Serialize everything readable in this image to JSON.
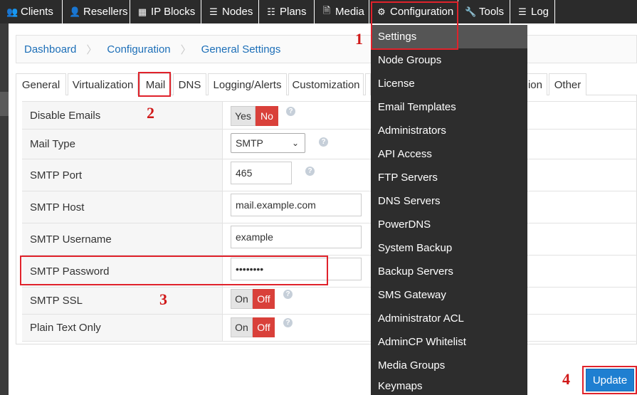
{
  "nav": {
    "items": [
      {
        "label": "Clients",
        "icon": "users-icon",
        "glyph": "👥"
      },
      {
        "label": "Resellers",
        "icon": "user-icon",
        "glyph": "👤"
      },
      {
        "label": "IP Blocks",
        "icon": "grid-icon",
        "glyph": "▦"
      },
      {
        "label": "Nodes",
        "icon": "server-icon",
        "glyph": "☰"
      },
      {
        "label": "Plans",
        "icon": "list-icon",
        "glyph": "☷"
      },
      {
        "label": "Media",
        "icon": "file-icon",
        "glyph": "🗎"
      },
      {
        "label": "Configuration",
        "icon": "gear-icon",
        "glyph": "⚙"
      },
      {
        "label": "Tools",
        "icon": "wrench-icon",
        "glyph": "🔧"
      },
      {
        "label": "Log",
        "icon": "list-icon",
        "glyph": "☰"
      }
    ]
  },
  "breadcrumb": [
    "Dashboard",
    "Configuration",
    "General Settings"
  ],
  "tabs": [
    "General",
    "Virtualization",
    "Mail",
    "DNS",
    "Logging/Alerts",
    "Customization",
    "ion",
    "Other"
  ],
  "form": {
    "disable_emails": {
      "label": "Disable Emails",
      "yes": "Yes",
      "no": "No"
    },
    "mail_type": {
      "label": "Mail Type",
      "value": "SMTP"
    },
    "smtp_port": {
      "label": "SMTP Port",
      "value": "465"
    },
    "smtp_host": {
      "label": "SMTP Host",
      "value": "mail.example.com"
    },
    "smtp_username": {
      "label": "SMTP Username",
      "value": "example"
    },
    "smtp_password": {
      "label": "SMTP Password",
      "value": "••••••••"
    },
    "smtp_ssl": {
      "label": "SMTP SSL",
      "on": "On",
      "off": "Off"
    },
    "plain_text": {
      "label": "Plain Text Only",
      "on": "On",
      "off": "Off"
    },
    "help_glyph": "?"
  },
  "dropdown": {
    "items": [
      "Settings",
      "Node Groups",
      "License",
      "Email Templates",
      "Administrators",
      "API Access",
      "FTP Servers",
      "DNS Servers",
      "PowerDNS",
      "System Backup",
      "Backup Servers",
      "SMS Gateway",
      "Administrator ACL",
      "AdminCP Whitelist",
      "Media Groups",
      "Keymaps"
    ]
  },
  "update_label": "Update",
  "annotations": [
    "1",
    "2",
    "3",
    "4"
  ],
  "colors": {
    "accent": "#1f7fd1",
    "danger": "#d9403a",
    "annotation": "#e0222b",
    "nav_bg": "#2b2b2b"
  }
}
